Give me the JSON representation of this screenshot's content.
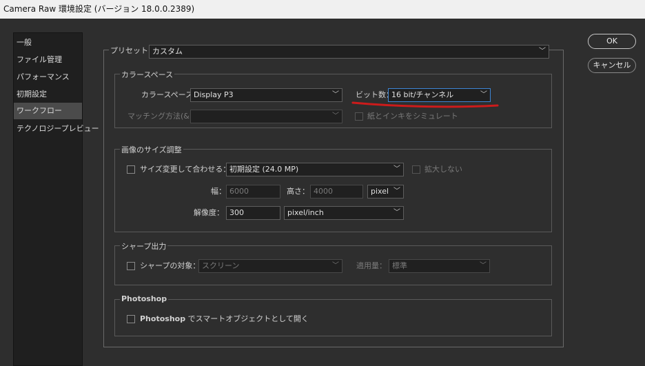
{
  "window": {
    "title": "Camera Raw 環境設定 (バージョン 18.0.0.2389)"
  },
  "sidebar": {
    "items": [
      {
        "label": "一般"
      },
      {
        "label": "ファイル管理"
      },
      {
        "label": "パフォーマンス"
      },
      {
        "label": "初期設定"
      },
      {
        "label": "ワークフロー",
        "active": true
      },
      {
        "label": "テクノロジープレビュー"
      }
    ]
  },
  "buttons": {
    "ok": "OK",
    "cancel": "キャンセル"
  },
  "preset": {
    "label": "プリセット：",
    "value": "カスタム"
  },
  "color_space": {
    "group_label": "カラースペース",
    "space_label": "カラースペース：",
    "space_value": "Display P3",
    "bit_label": "ビット数：",
    "bit_value": "16 bit/チャンネル",
    "matching_label": "マッチング方法(&I)：",
    "matching_value": "",
    "paper_ink_label": "紙とインキをシミュレート"
  },
  "image_size": {
    "group_label": "画像のサイズ調整",
    "resize_label": "サイズ変更して合わせる：",
    "resize_value": "初期設定 (24.0 MP)",
    "no_enlarge_label": "拡大しない",
    "width_label": "幅：",
    "width_value": "6000",
    "height_label": "高さ：",
    "height_value": "4000",
    "unit_value": "pixel",
    "resolution_label": "解像度：",
    "resolution_value": "300",
    "resolution_unit_value": "pixel/inch"
  },
  "sharpen": {
    "group_label": "シャープ出力",
    "target_label": "シャープの対象：",
    "target_value": "スクリーン",
    "amount_label": "適用量：",
    "amount_value": "標準"
  },
  "photoshop": {
    "group_label": "Photoshop",
    "smart_object_bold": "Photoshop",
    "smart_object_label": " でスマートオブジェクトとして開く"
  },
  "colors": {
    "annotation": "#cc1b1b",
    "focus": "#3d86d6"
  }
}
